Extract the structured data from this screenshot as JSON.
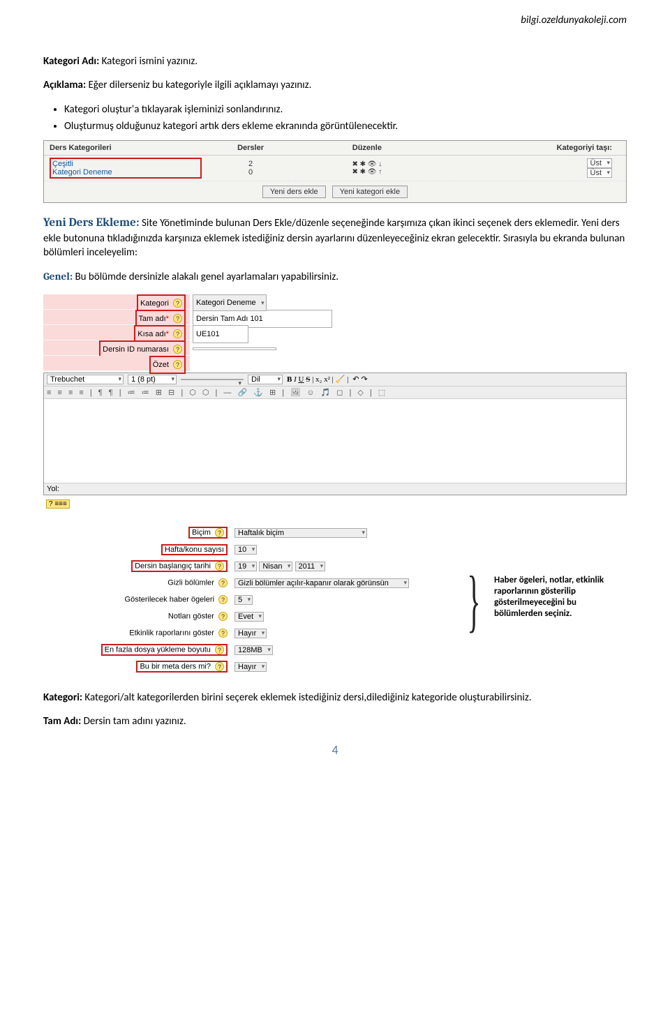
{
  "url": "bilgi.ozeldunyakoleji.com",
  "p1_label": "Kategori Adı:",
  "p1_text": " Kategori ismini yazınız.",
  "p2_label": "Açıklama:",
  "p2_text": " Eğer dilerseniz bu kategoriyle ilgili açıklamayı yazınız.",
  "bul1": "Kategori oluştur'a tıklayarak işleminizi sonlandırınız.",
  "bul2": "Oluşturmuş olduğunuz kategori artık ders ekleme ekranında görüntülenecektir.",
  "tbl1": {
    "h1": "Ders Kategorileri",
    "h2": "Dersler",
    "h3": "Düzenle",
    "h4": "Kategoriyi taşı:",
    "r1c1": "Çeşitli",
    "r1c2": "2",
    "r1c3": "✖ ✱ 👁 ↓",
    "r1c4": "Üst",
    "r2c1": "Kategori Deneme",
    "r2c2": "0",
    "r2c3": "✖ ✱ 👁 ↑",
    "r2c4": "Üst",
    "btn1": "Yeni ders ekle",
    "btn2": "Yeni kategori ekle"
  },
  "yeni_h": "Yeni Ders Ekleme:",
  "yeni_t": " Site Yönetiminde bulunan Ders Ekle/düzenle seçeneğinde karşımıza çıkan ikinci seçenek ders eklemedir. Yeni ders ekle butonuna tıkladığınızda karşınıza eklemek istediğiniz dersin ayarlarını düzenleyeceğiniz ekran gelecektir. Sırasıyla bu ekranda bulunan bölümleri inceleyelim:",
  "genel_h": "Genel:",
  "genel_t": " Bu bölümde dersinizle alakalı genel ayarlamaları yapabilirsiniz.",
  "form2": {
    "kategori_l": "Kategori",
    "kategori_v": "Kategori Deneme",
    "tam_l": "Tam adı",
    "tam_v": "Dersin Tam Adı 101",
    "kisa_l": "Kısa adı",
    "kisa_v": "UE101",
    "id_l": "Dersin ID numarası",
    "ozet_l": "Özet",
    "font": "Trebuchet",
    "size": "1 (8 pt)",
    "lang": "Dil",
    "yol": "Yol:"
  },
  "form3": {
    "bicim_l": "Biçim",
    "bicim_v": "Haftalık biçim",
    "hafta_l": "Hafta/konu sayısı",
    "hafta_v": "10",
    "tarih_l": "Dersin başlangıç tarihi",
    "tarih_d": "19",
    "tarih_m": "Nisan",
    "tarih_y": "2011",
    "gizli_l": "Gizli bölümler",
    "gizli_v": "Gizli bölümler açılır-kapanır olarak görünsün",
    "haber_l": "Gösterilecek haber ögeleri",
    "haber_v": "5",
    "not_l": "Notları göster",
    "not_v": "Evet",
    "etk_l": "Etkinlik raporlarını göster",
    "etk_v": "Hayır",
    "dosya_l": "En fazla dosya yükleme boyutu",
    "dosya_v": "128MB",
    "meta_l": "Bu bir meta ders mi?",
    "meta_v": "Hayır",
    "note": "Haber ögeleri, notlar, etkinlik raporlarının gösterilip gösterilmeyeceğini bu bölümlerden seçiniz."
  },
  "p_kategori_l": "Kategori:",
  "p_kategori_t": " Kategori/alt kategorilerden birini seçerek eklemek istediğiniz dersi,dilediğiniz kategoride oluşturabilirsiniz.",
  "p_tam_l": "Tam Adı:",
  "p_tam_t": " Dersin tam adını yazınız.",
  "page": "4"
}
